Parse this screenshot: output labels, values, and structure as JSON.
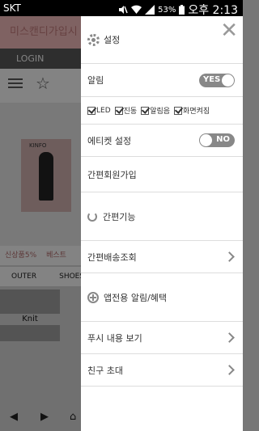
{
  "status_bar": {
    "carrier": "SKT",
    "battery": "53%",
    "time": "오후 2:13"
  },
  "background": {
    "title": "미스캔디가입시",
    "login": "LOGIN",
    "banner_tag": "KINFO",
    "cat_row1": [
      "신상품5%",
      "베스트"
    ],
    "cat_row2": [
      "OUTER",
      "SHOES&"
    ],
    "product_label": "Knit"
  },
  "drawer": {
    "header": "설정",
    "rows": {
      "alarm": "알림",
      "alarm_toggle": "YES",
      "checks": [
        "LED",
        "진동",
        "알림음",
        "화면켜짐"
      ],
      "etiquette": "에티켓 설정",
      "etiquette_toggle": "NO",
      "simple_join": "간편회원가입",
      "simple_func": "간편기능",
      "delivery": "간편배송조회",
      "app_alarm": "앱전용 알림/혜택",
      "push_view": "푸시 내용 보기",
      "invite": "친구 초대"
    }
  }
}
